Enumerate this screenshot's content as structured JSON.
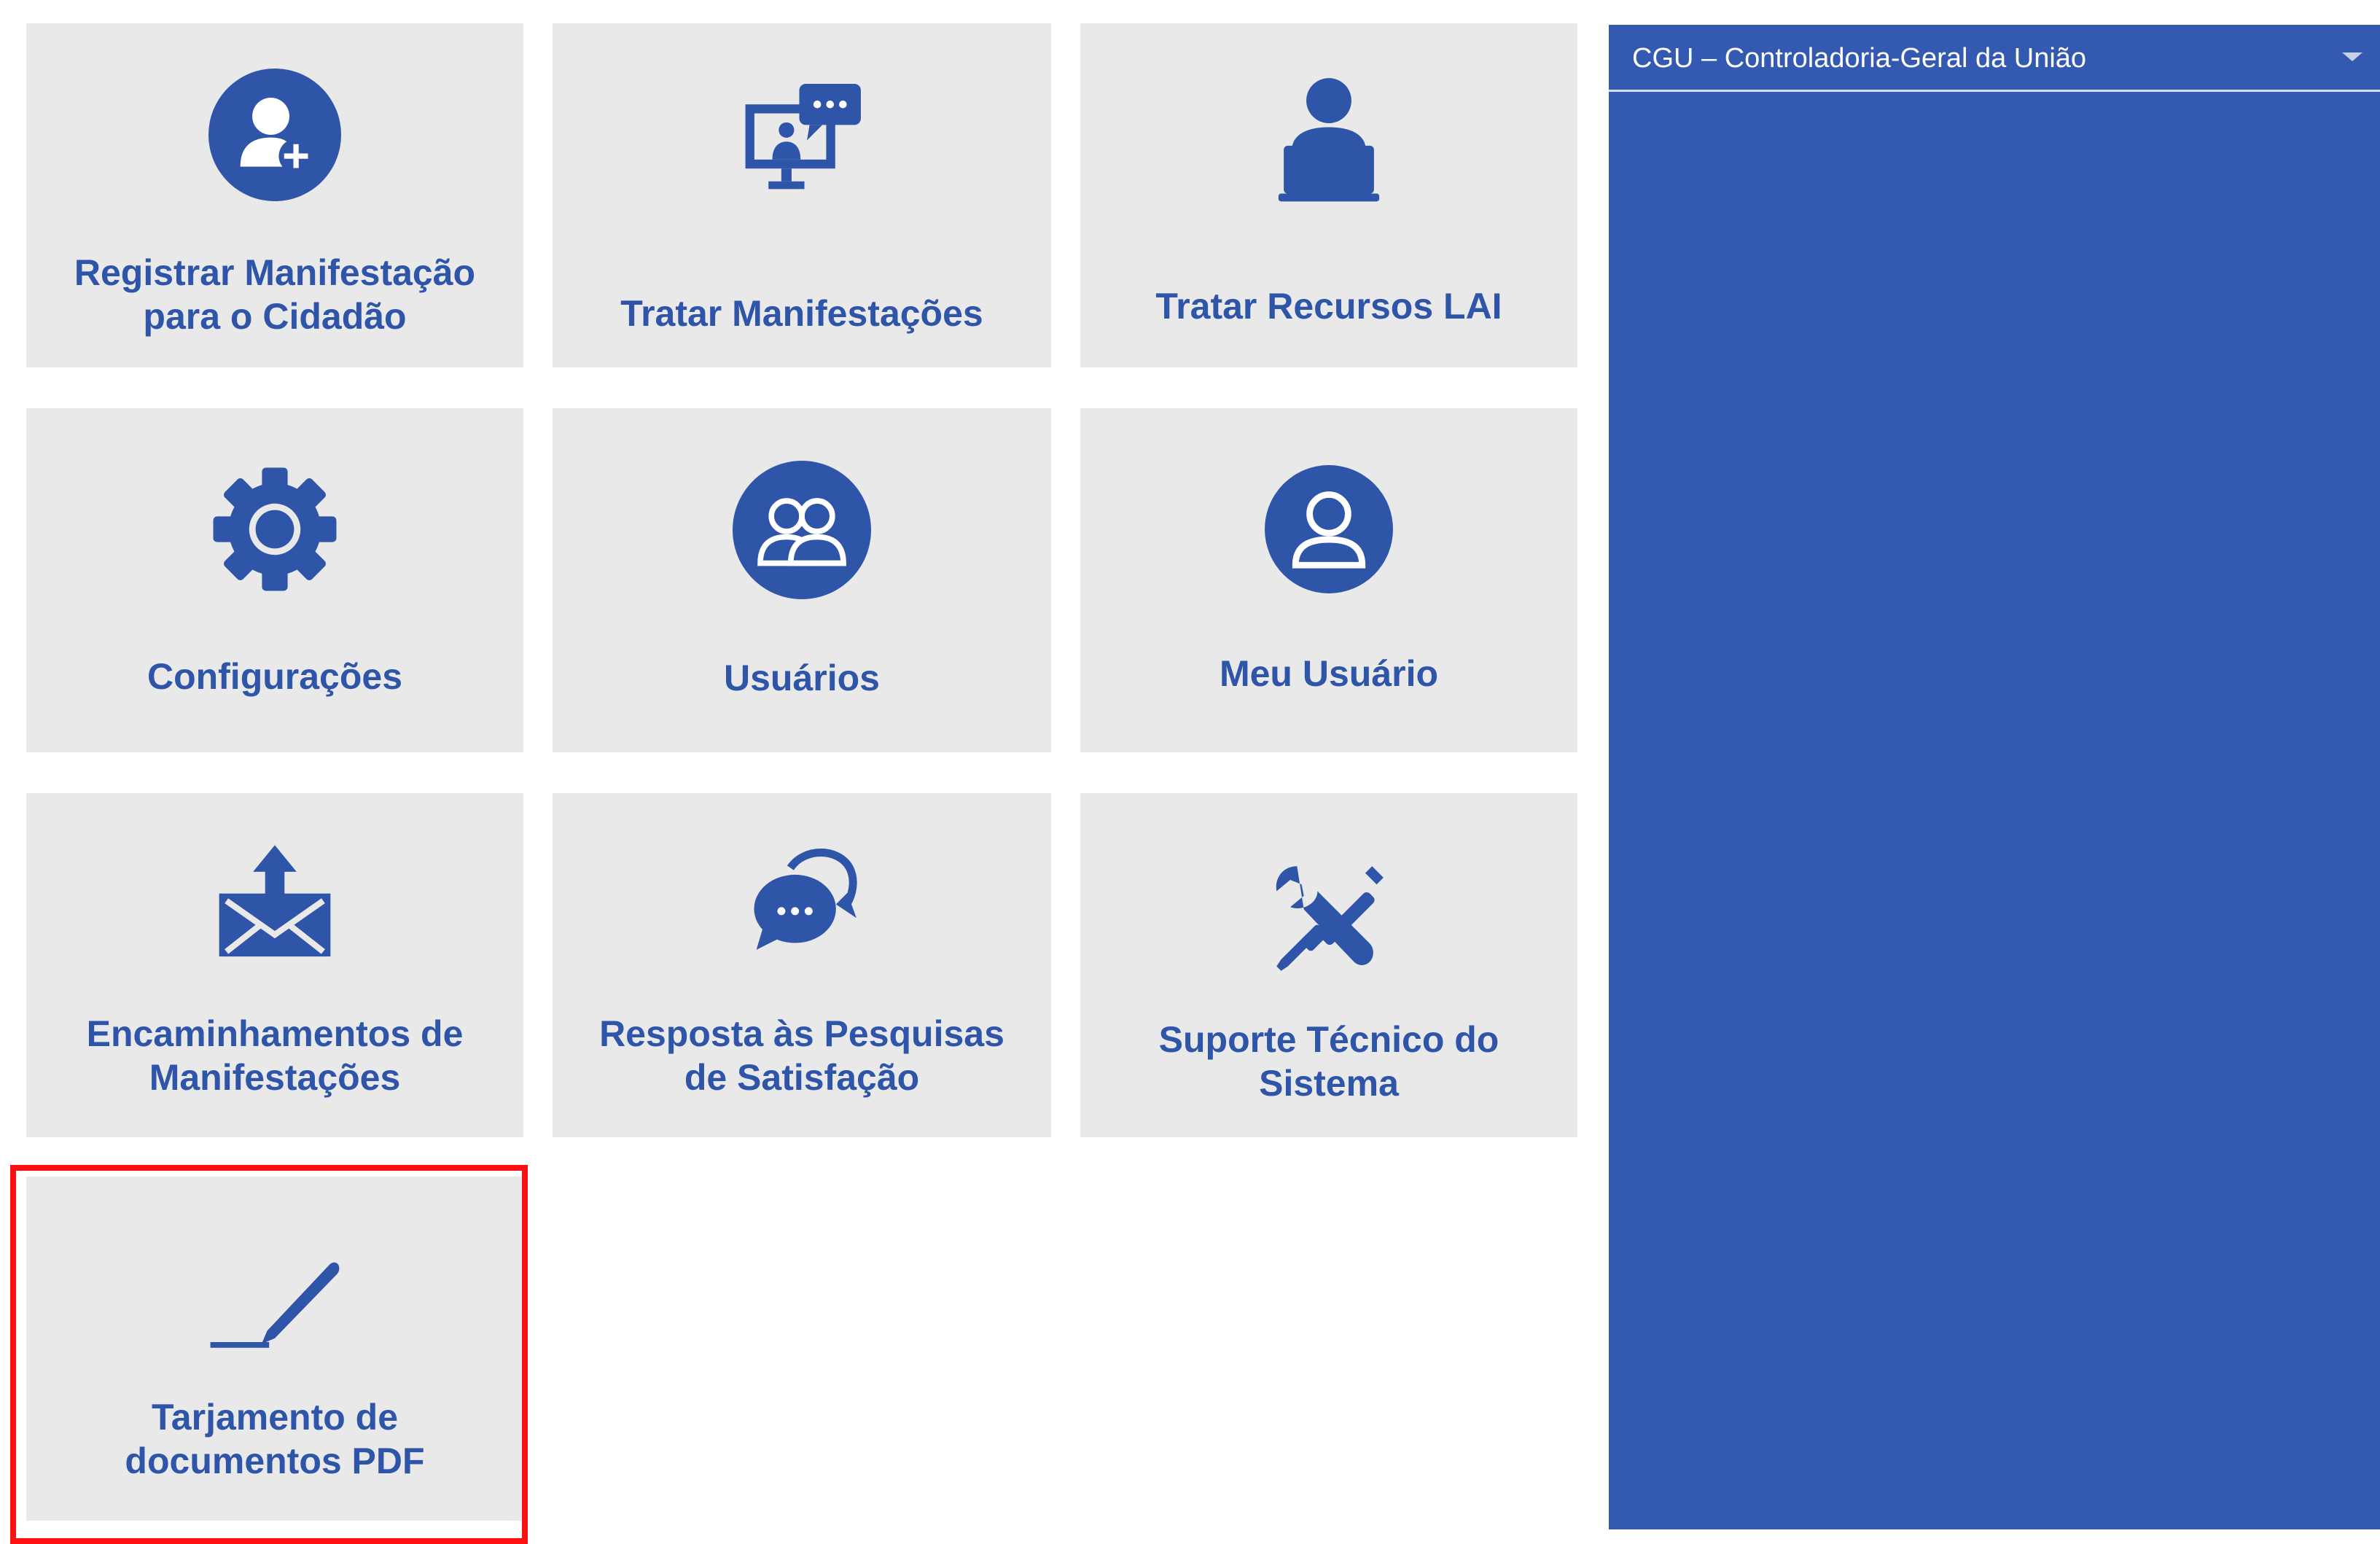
{
  "tiles": [
    {
      "label": "Registrar Manifestação\npara o Cidadão",
      "icon": "user-add-icon"
    },
    {
      "label": "Tratar Manifestações",
      "icon": "monitor-chat-icon"
    },
    {
      "label": "Tratar Recursos LAI",
      "icon": "user-laptop-icon"
    },
    {
      "label": "Configurações",
      "icon": "gear-icon"
    },
    {
      "label": "Usuários",
      "icon": "users-icon"
    },
    {
      "label": "Meu Usuário",
      "icon": "user-circle-icon"
    },
    {
      "label": "Encaminhamentos de\nManifestações",
      "icon": "envelope-upload-icon"
    },
    {
      "label": "Resposta às Pesquisas\nde Satisfação",
      "icon": "chat-bubbles-icon"
    },
    {
      "label": "Suporte Técnico do\nSistema",
      "icon": "tools-icon"
    },
    {
      "label": "Tarjamento de\ndocumentos PDF",
      "icon": "pen-signature-icon"
    }
  ],
  "org_select": {
    "value": "CGU – Controladoria-Geral da União"
  },
  "colors": {
    "accent": "#2e55a8",
    "panel": "#3359b0",
    "tile": "#e9e9e9",
    "highlight": "#ff1010"
  }
}
